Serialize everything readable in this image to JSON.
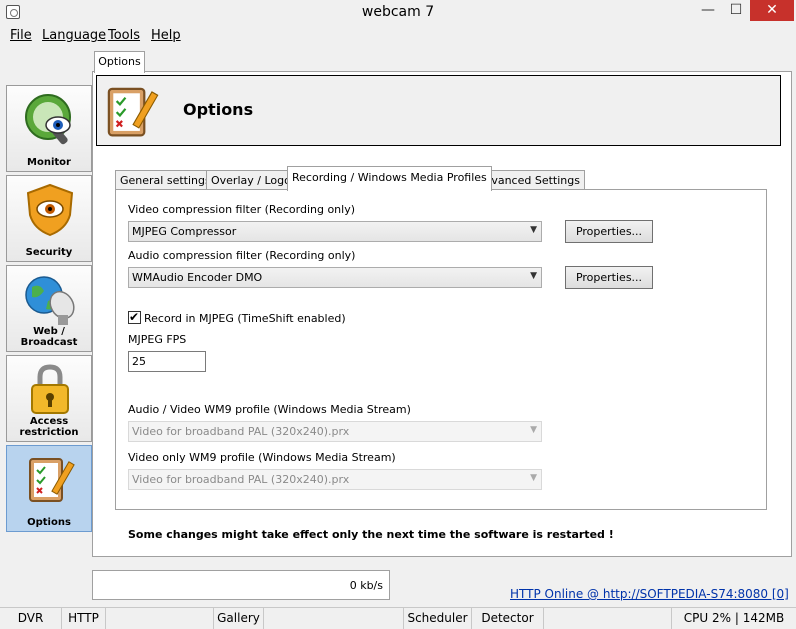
{
  "window": {
    "title": "webcam 7",
    "minimize": "—",
    "maximize": "☐",
    "close": "✕"
  },
  "menu": [
    "File",
    "Language",
    "Tools",
    "Help"
  ],
  "sidebar": [
    {
      "label": "Monitor",
      "icon": "monitor-eye-icon"
    },
    {
      "label": "Security",
      "icon": "security-shield-eye-icon"
    },
    {
      "label": "Web / Broadcast",
      "icon": "globe-satellite-icon"
    },
    {
      "label": "Access restriction",
      "icon": "padlock-icon"
    },
    {
      "label": "Options",
      "icon": "checklist-clipboard-icon",
      "active": true
    }
  ],
  "options_tab": "Options",
  "header": {
    "title": "Options"
  },
  "tabs": [
    "General settings",
    "Overlay / Logo",
    "Recording / Windows Media Profiles",
    "Advanced Settings"
  ],
  "active_tab": "Recording / Windows Media Profiles",
  "form": {
    "video_filter_label": "Video compression filter (Recording only)",
    "video_filter_value": "MJPEG Compressor",
    "audio_filter_label": "Audio compression filter (Recording only)",
    "audio_filter_value": "WMAudio Encoder DMO",
    "properties_label": "Properties...",
    "record_mjpeg_label": "Record in MJPEG (TimeShift enabled)",
    "record_mjpeg_checked": true,
    "mjpeg_fps_label": "MJPEG FPS",
    "mjpeg_fps_value": "25",
    "av_profile_label": "Audio / Video WM9 profile (Windows Media Stream)",
    "av_profile_value": "Video for broadband PAL (320x240).prx",
    "video_profile_label": "Video only WM9 profile (Windows Media Stream)",
    "video_profile_value": "Video for broadband PAL (320x240).prx"
  },
  "restart_note": "Some changes might take effect only the next time the software is restarted !",
  "rate": "0 kb/s",
  "http_status": "HTTP Online @ http://SOFTPEDIA-S74:8080 [0]",
  "statusbar": [
    "DVR",
    "HTTP",
    "",
    "Gallery",
    "",
    "Scheduler",
    "Detector",
    "",
    "CPU 2% | 142MB"
  ]
}
